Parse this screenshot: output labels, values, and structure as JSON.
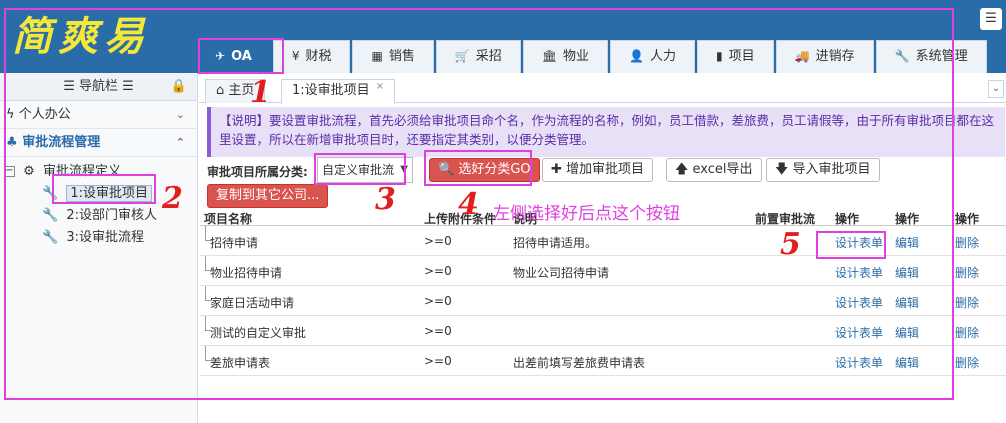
{
  "app": {
    "logo_text": "简爽易",
    "menu_icon": "hamburger-icon"
  },
  "topnav": [
    {
      "label": "OA",
      "icon": "send-icon",
      "glyph": "✈"
    },
    {
      "label": "财税",
      "icon": "yen-icon",
      "glyph": "¥"
    },
    {
      "label": "销售",
      "icon": "table-icon",
      "glyph": "▦"
    },
    {
      "label": "采招",
      "icon": "cart-icon",
      "glyph": "🛒"
    },
    {
      "label": "物业",
      "icon": "bank-icon",
      "glyph": "🏛"
    },
    {
      "label": "人力",
      "icon": "user-icon",
      "glyph": "👤"
    },
    {
      "label": "项目",
      "icon": "phone-icon",
      "glyph": "▮"
    },
    {
      "label": "进销存",
      "icon": "truck-icon",
      "glyph": "🚚"
    },
    {
      "label": "系统管理",
      "icon": "wrench-icon",
      "glyph": "🔧"
    }
  ],
  "sidebar": {
    "title": "☰ 导航栏 ☰",
    "sections": [
      {
        "label": "个人办公",
        "icon": "bolt-icon",
        "glyph": "ϟ"
      },
      {
        "label": "审批流程管理",
        "icon": "tree-icon",
        "glyph": "♣"
      }
    ],
    "tree": {
      "root": {
        "toggle": "−",
        "label": "审批流程定义",
        "glyph": "⚙"
      },
      "children": [
        {
          "label": "1:设审批项目",
          "glyph": "🔧"
        },
        {
          "label": "2:设部门审核人",
          "glyph": "🔧"
        },
        {
          "label": "3:设审批流程",
          "glyph": "🔧"
        }
      ]
    }
  },
  "content_tabs": {
    "home": "主页",
    "home_glyph": "⌂",
    "current": "1:设审批项目",
    "close": "×",
    "more": "⌄"
  },
  "notice": "【说明】要设置审批流程，首先必须给审批项目命个名，作为流程的名称，例如，员工借款，差旅费，员工请假等，由于所有审批项目都在这里设置，所以在新增审批项目时，还要指定其类别，以便分类管理。",
  "toolbar": {
    "category_label": "审批项目所属分类:",
    "category_value": "自定义审批流",
    "go_label": "选好分类GO",
    "add_label": "增加审批项目",
    "excel_label": "excel导出",
    "import_label": "导入审批项目",
    "copy_label": "复制到其它公司..."
  },
  "table": {
    "headers": {
      "name": "项目名称",
      "attach": "上传附件条件",
      "desc": "说明",
      "pre": "前置审批流",
      "op1": "操作",
      "op2": "操作",
      "op3": "操作"
    },
    "rows": [
      {
        "name": "招待申请",
        "attach": ">=0",
        "desc": "招待申请适用。",
        "op1": "设计表单",
        "op2": "编辑",
        "op3": "删除"
      },
      {
        "name": "物业招待申请",
        "attach": ">=0",
        "desc": "物业公司招待申请",
        "op1": "设计表单",
        "op2": "编辑",
        "op3": "删除"
      },
      {
        "name": "家庭日活动申请",
        "attach": ">=0",
        "desc": "",
        "op1": "设计表单",
        "op2": "编辑",
        "op3": "删除"
      },
      {
        "name": "测试的自定义审批",
        "attach": ">=0",
        "desc": "",
        "op1": "设计表单",
        "op2": "编辑",
        "op3": "删除"
      },
      {
        "name": "差旅申请表",
        "attach": ">=0",
        "desc": "出差前填写差旅费申请表",
        "op1": "设计表单",
        "op2": "编辑",
        "op3": "删除"
      }
    ]
  },
  "annotations": {
    "n1": "1",
    "n2": "2",
    "n3": "3",
    "n4": "4",
    "n5": "5",
    "hint": "左侧选择好后点这个按钮",
    "color": "#e040e0"
  },
  "colors": {
    "header": "#2a6ca8",
    "notice_bg": "#e8e0f7",
    "danger": "#d9534f",
    "logo": "#f5e63a"
  }
}
